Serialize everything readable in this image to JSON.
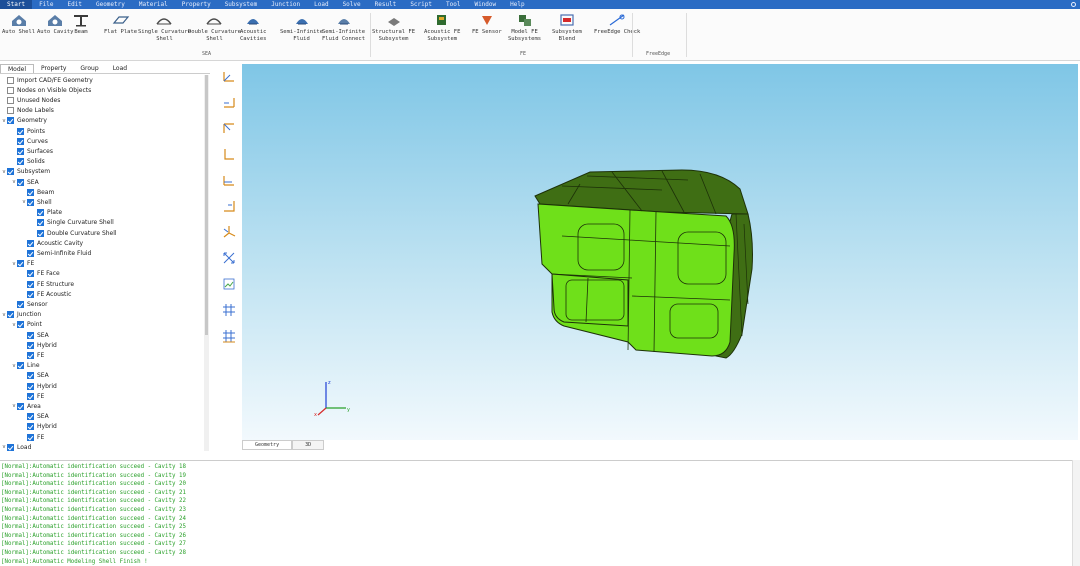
{
  "menu": [
    "Start",
    "File",
    "Edit",
    "Geometry",
    "Material",
    "Property",
    "Subsystem",
    "Junction",
    "Load",
    "Solve",
    "Result",
    "Script",
    "Tool",
    "Window",
    "Help"
  ],
  "ribbon": {
    "buttons": [
      {
        "label": "Auto Shell",
        "icon": "auto-shell-icon"
      },
      {
        "label": "Auto Cavity",
        "icon": "auto-cavity-icon"
      },
      {
        "label": "Beam",
        "icon": "beam-icon"
      },
      {
        "label": "Flat Plate",
        "icon": "flat-plate-icon"
      },
      {
        "label": "Single Curvature\nShell",
        "icon": "single-curvature-shell-icon"
      },
      {
        "label": "Double Curvature\nShell",
        "icon": "double-curvature-shell-icon"
      },
      {
        "label": "Acoustic\nCavities",
        "icon": "acoustic-cavities-icon"
      },
      {
        "label": "Semi-Infinite\nFluid",
        "icon": "semi-infinite-fluid-icon"
      },
      {
        "label": "Semi-Infinite\nFluid Connect",
        "icon": "semi-infinite-fluid-connect-icon"
      },
      {
        "label": "Structural FE\nSubsystem",
        "icon": "structural-fe-subsystem-icon"
      },
      {
        "label": "Acoustic FE\nSubsystem",
        "icon": "acoustic-fe-subsystem-icon"
      },
      {
        "label": "FE Sensor",
        "icon": "fe-sensor-icon"
      },
      {
        "label": "Model FE\nSubsystems",
        "icon": "model-fe-subsystems-icon"
      },
      {
        "label": "Subsystem\nBlend",
        "icon": "subsystem-blend-icon"
      },
      {
        "label": "FreeEdge Check",
        "icon": "freeedge-check-icon"
      }
    ],
    "groups": [
      "SEA",
      "FE",
      "FreeEdge"
    ]
  },
  "panel": {
    "tabs": [
      "Model",
      "Property",
      "Group",
      "Load"
    ],
    "tree": [
      {
        "label": "Import CAD/FE Geometry",
        "level": 0,
        "checked": false,
        "tw": ""
      },
      {
        "label": "Nodes on Visible Objects",
        "level": 0,
        "checked": false,
        "tw": ""
      },
      {
        "label": "Unused Nodes",
        "level": 0,
        "checked": false,
        "tw": ""
      },
      {
        "label": "Node Labels",
        "level": 0,
        "checked": false,
        "tw": ""
      },
      {
        "label": "Geometry",
        "level": 0,
        "checked": true,
        "tw": "v"
      },
      {
        "label": "Points",
        "level": 1,
        "checked": true,
        "tw": ""
      },
      {
        "label": "Curves",
        "level": 1,
        "checked": true,
        "tw": ""
      },
      {
        "label": "Surfaces",
        "level": 1,
        "checked": true,
        "tw": ""
      },
      {
        "label": "Solids",
        "level": 1,
        "checked": true,
        "tw": ""
      },
      {
        "label": "Subsystem",
        "level": 0,
        "checked": true,
        "tw": "v"
      },
      {
        "label": "SEA",
        "level": 1,
        "checked": true,
        "tw": "v"
      },
      {
        "label": "Beam",
        "level": 2,
        "checked": true,
        "tw": ""
      },
      {
        "label": "Shell",
        "level": 2,
        "checked": true,
        "tw": "v"
      },
      {
        "label": "Plate",
        "level": 3,
        "checked": true,
        "tw": ""
      },
      {
        "label": "Single Curvature Shell",
        "level": 3,
        "checked": true,
        "tw": ""
      },
      {
        "label": "Double Curvature Shell",
        "level": 3,
        "checked": true,
        "tw": ""
      },
      {
        "label": "Acoustic Cavity",
        "level": 2,
        "checked": true,
        "tw": ""
      },
      {
        "label": "Semi-Infinite Fluid",
        "level": 2,
        "checked": true,
        "tw": ""
      },
      {
        "label": "FE",
        "level": 1,
        "checked": true,
        "tw": "v"
      },
      {
        "label": "FE Face",
        "level": 2,
        "checked": true,
        "tw": ""
      },
      {
        "label": "FE Structure",
        "level": 2,
        "checked": true,
        "tw": ""
      },
      {
        "label": "FE Acoustic",
        "level": 2,
        "checked": true,
        "tw": ""
      },
      {
        "label": "Sensor",
        "level": 1,
        "checked": true,
        "tw": ""
      },
      {
        "label": "Junction",
        "level": 0,
        "checked": true,
        "tw": "v"
      },
      {
        "label": "Point",
        "level": 1,
        "checked": true,
        "tw": "v"
      },
      {
        "label": "SEA",
        "level": 2,
        "checked": true,
        "tw": ""
      },
      {
        "label": "Hybrid",
        "level": 2,
        "checked": true,
        "tw": ""
      },
      {
        "label": "FE",
        "level": 2,
        "checked": true,
        "tw": ""
      },
      {
        "label": "Line",
        "level": 1,
        "checked": true,
        "tw": "v"
      },
      {
        "label": "SEA",
        "level": 2,
        "checked": true,
        "tw": ""
      },
      {
        "label": "Hybrid",
        "level": 2,
        "checked": true,
        "tw": ""
      },
      {
        "label": "FE",
        "level": 2,
        "checked": true,
        "tw": ""
      },
      {
        "label": "Area",
        "level": 1,
        "checked": true,
        "tw": "v"
      },
      {
        "label": "SEA",
        "level": 2,
        "checked": true,
        "tw": ""
      },
      {
        "label": "Hybrid",
        "level": 2,
        "checked": true,
        "tw": ""
      },
      {
        "label": "FE",
        "level": 2,
        "checked": true,
        "tw": ""
      },
      {
        "label": "Load",
        "level": 0,
        "checked": true,
        "tw": "v"
      }
    ]
  },
  "viewport": {
    "tabs": [
      "Geometry",
      "3D"
    ],
    "axis": {
      "x": "x",
      "y": "y",
      "z": "z"
    }
  },
  "console": {
    "lines": [
      "[Normal]:Automatic identification succeed - Cavity 18",
      "[Normal]:Automatic identification succeed - Cavity 19",
      "[Normal]:Automatic identification succeed - Cavity 20",
      "[Normal]:Automatic identification succeed - Cavity 21",
      "[Normal]:Automatic identification succeed - Cavity 22",
      "[Normal]:Automatic identification succeed - Cavity 23",
      "[Normal]:Automatic identification succeed - Cavity 24",
      "[Normal]:Automatic identification succeed - Cavity 25",
      "[Normal]:Automatic identification succeed - Cavity 26",
      "[Normal]:Automatic identification succeed - Cavity 27",
      "[Normal]:Automatic identification succeed - Cavity 28",
      "[Normal]:Automatic Modeling Shell Finish !"
    ]
  },
  "colors": {
    "menubar": "#2b6cc4",
    "model_front": "#6fe01a",
    "model_top": "#3f6e14",
    "log_text": "#2aa02a",
    "checkbox": "#1e73d8"
  }
}
